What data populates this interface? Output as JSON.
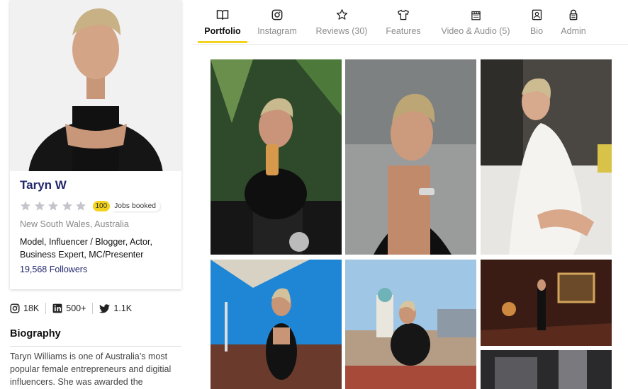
{
  "profile": {
    "name": "Taryn W",
    "rating_stars": 5,
    "jobs_count": "100",
    "jobs_label": "Jobs booked",
    "location": "New South Wales, Australia",
    "roles": "Model, Influencer / Blogger, Actor, Business Expert, MC/Presenter",
    "followers": "19,568 Followers"
  },
  "social": {
    "instagram": "18K",
    "linkedin": "500+",
    "twitter": "1.1K"
  },
  "biography": {
    "title": "Biography",
    "text": "Taryn Williams is one of Australia’s most popular female entrepreneurs and digitial influencers. She was awarded the"
  },
  "tabs": [
    {
      "label": "Portfolio",
      "icon": "book-icon",
      "active": true
    },
    {
      "label": "Instagram",
      "icon": "instagram-icon",
      "active": false
    },
    {
      "label": "Reviews (30)",
      "icon": "star-icon",
      "active": false
    },
    {
      "label": "Features",
      "icon": "shirt-icon",
      "active": false
    },
    {
      "label": "Video & Audio (5)",
      "icon": "clapperboard-icon",
      "active": false
    },
    {
      "label": "Bio",
      "icon": "id-card-icon",
      "active": false
    },
    {
      "label": "Admin",
      "icon": "lock-icon",
      "active": false
    }
  ],
  "colors": {
    "accent": "#f2d21c",
    "brand": "#24286b",
    "star": "#c4c4cc"
  }
}
